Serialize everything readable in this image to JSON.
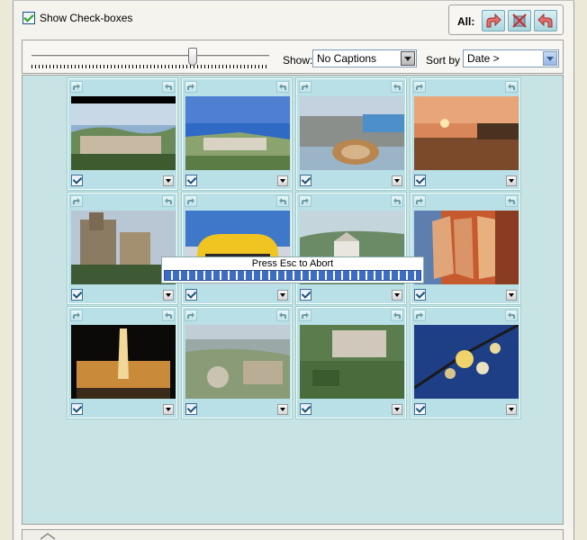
{
  "toolbar": {
    "show_checkboxes_label": "Show Check-boxes",
    "show_checkboxes_checked": true,
    "all_label": "All:",
    "all_buttons": [
      "forward-arrow-icon",
      "delete-cross-icon",
      "back-arrow-icon"
    ]
  },
  "view": {
    "zoom_slider_level": 0.68,
    "show_label": "Show:",
    "show_value": "No Captions",
    "sort_label": "Sort by",
    "sort_value": "Date >"
  },
  "gallery": {
    "background_color": "#c8e3e3",
    "thumbnails": [
      {
        "subject": "city-bay-panorama",
        "checked": true
      },
      {
        "subject": "harbor-aerial-view",
        "checked": true
      },
      {
        "subject": "bullring-aerial-view",
        "checked": true
      },
      {
        "subject": "harbor-sunset",
        "checked": true
      },
      {
        "subject": "cathedral",
        "checked": true
      },
      {
        "subject": "yellow-sports-car",
        "checked": true
      },
      {
        "subject": "hillside-white-building",
        "checked": true
      },
      {
        "subject": "cubist-painting",
        "checked": true
      },
      {
        "subject": "illuminated-fountain-night",
        "checked": true
      },
      {
        "subject": "city-roundabout-aerial",
        "checked": true
      },
      {
        "subject": "palace-gardens-aerial",
        "checked": true
      },
      {
        "subject": "blossoms-blue-sky",
        "checked": true
      }
    ]
  },
  "progress": {
    "label": "Press Esc to Abort",
    "fraction": 1.0,
    "color": "#3c6cc4"
  }
}
